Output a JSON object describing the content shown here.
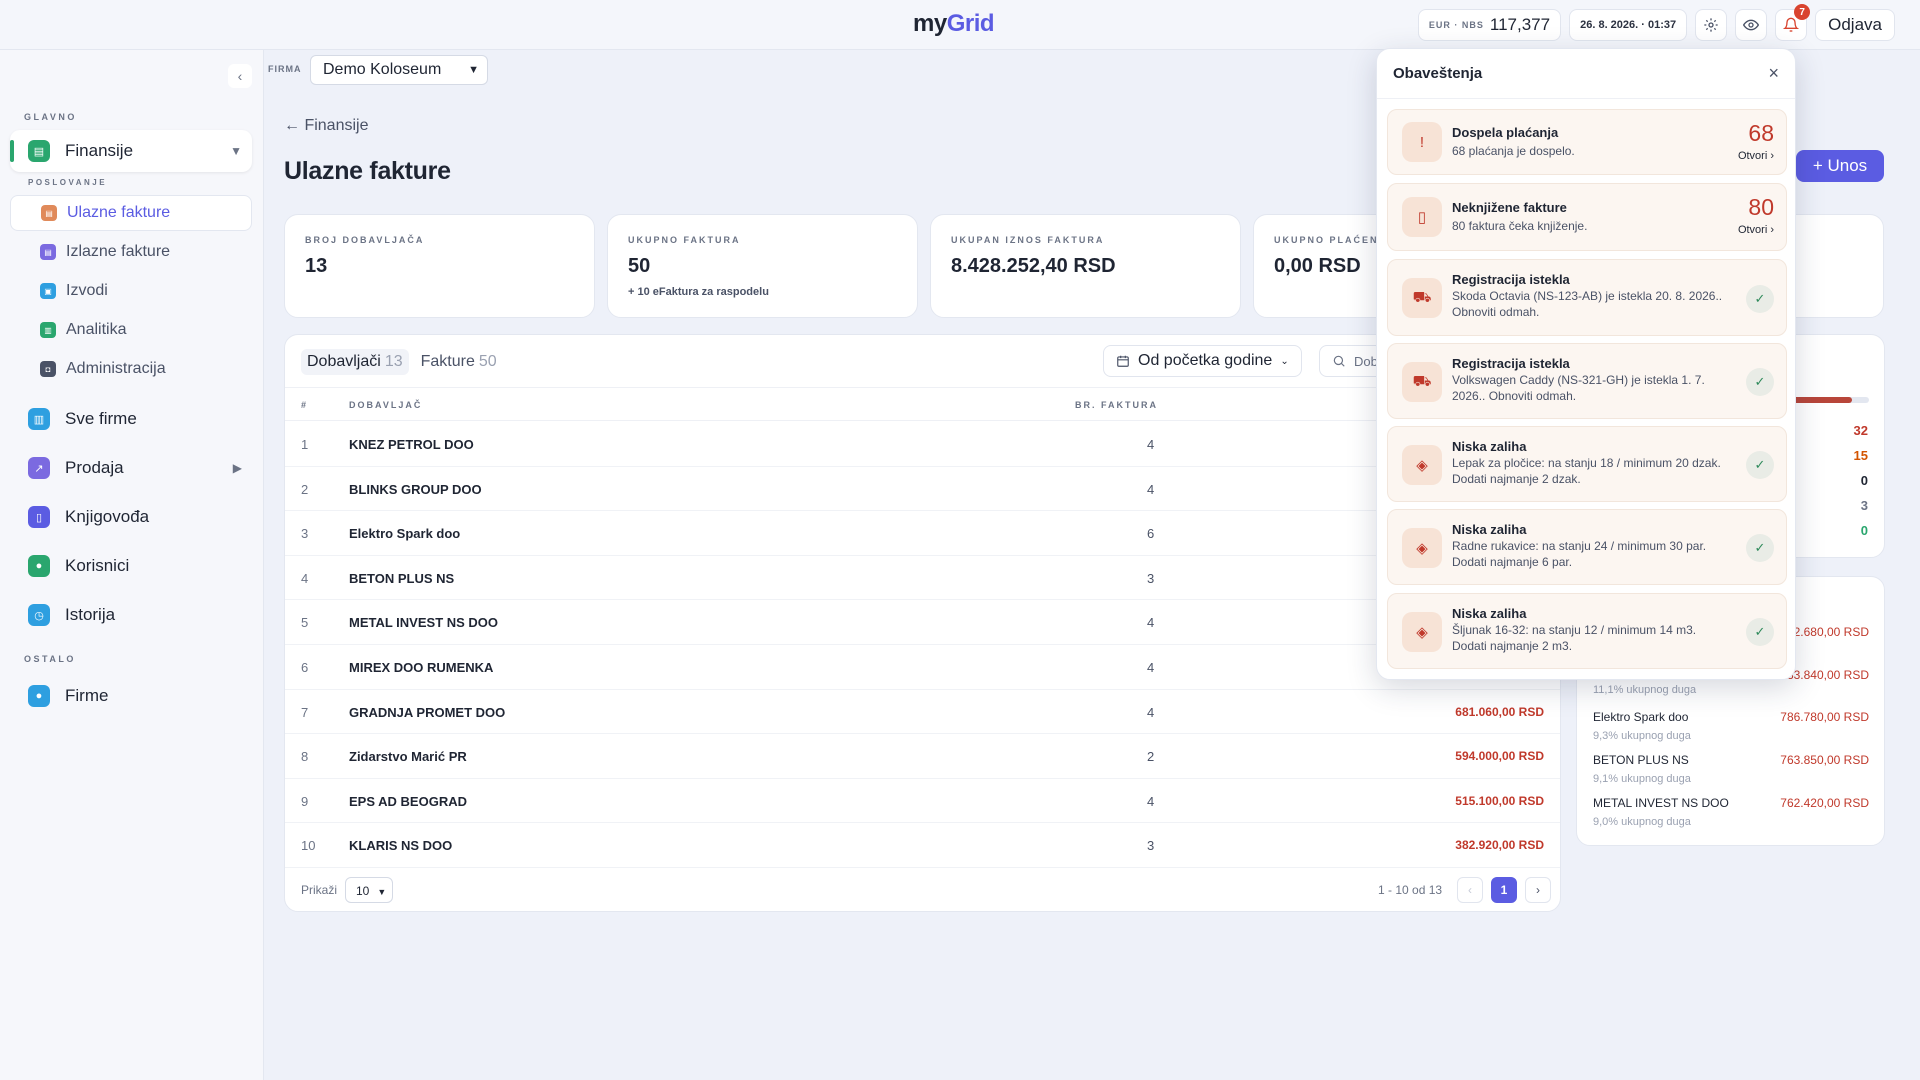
{
  "header": {
    "logo_my": "my",
    "logo_grid": "Grid",
    "rate_label": "EUR · NBS",
    "rate_value": "117,377",
    "datetime": "26. 8. 2026. · 01:37",
    "notif_count": "7",
    "logout": "Odjava"
  },
  "sidebar": {
    "collapse_icon": "‹",
    "section_main": "GLAVNO",
    "finance": "Finansije",
    "section_business": "POSLOVANJE",
    "sub": [
      "Ulazne fakture",
      "Izlazne fakture",
      "Izvodi",
      "Analitika",
      "Administracija"
    ],
    "items": [
      "Sve firme",
      "Prodaja",
      "Knjigovođa",
      "Korisnici",
      "Istorija"
    ],
    "section_other": "OSTALO",
    "firms": "Firme"
  },
  "company": {
    "label": "FIRMA",
    "value": "Demo Koloseum"
  },
  "page": {
    "back": "← Finansije",
    "title": "Ulazne fakture",
    "add": "+ Unos"
  },
  "stats": [
    {
      "label": "BROJ DOBAVLJAČA",
      "value": "13",
      "sub": ""
    },
    {
      "label": "UKUPNO FAKTURA",
      "value": "50",
      "sub": "+ 10 eFaktura za raspodelu"
    },
    {
      "label": "UKUPAN IZNOS FAKTURA",
      "value": "8.428.252,40 RSD",
      "sub": ""
    },
    {
      "label": "UKUPNO PLAĆENO",
      "value": "0,00 RSD",
      "sub": ""
    }
  ],
  "table": {
    "tab_suppliers": "Dobavljači",
    "tab_suppliers_count": "13",
    "tab_invoices": "Fakture",
    "tab_invoices_count": "50",
    "period": "Od početka godine",
    "search_placeholder": "Dob",
    "col_num": "#",
    "col_supplier": "DOBAVLJAČ",
    "col_count": "BR. FAKTURA",
    "rows": [
      {
        "n": "1",
        "name": "KNEZ PETROL DOO",
        "count": "4",
        "amount": ""
      },
      {
        "n": "2",
        "name": "BLINKS GROUP DOO",
        "count": "4",
        "amount": ""
      },
      {
        "n": "3",
        "name": "Elektro Spark doo",
        "count": "6",
        "amount": ""
      },
      {
        "n": "4",
        "name": "BETON PLUS NS",
        "count": "3",
        "amount": ""
      },
      {
        "n": "5",
        "name": "METAL INVEST NS DOO",
        "count": "4",
        "amount": ""
      },
      {
        "n": "6",
        "name": "MIREX DOO RUMENKA",
        "count": "4",
        "amount": ""
      },
      {
        "n": "7",
        "name": "GRADNJA PROMET DOO",
        "count": "4",
        "amount": "681.060,00 RSD"
      },
      {
        "n": "8",
        "name": "Zidarstvo Marić PR",
        "count": "2",
        "amount": "594.000,00 RSD"
      },
      {
        "n": "9",
        "name": "EPS AD BEOGRAD",
        "count": "4",
        "amount": "515.100,00 RSD"
      },
      {
        "n": "10",
        "name": "KLARIS NS DOO",
        "count": "3",
        "amount": "382.920,00 RSD"
      }
    ],
    "show_label": "Prikaži",
    "page_size": "10",
    "range": "1 - 10 od 13",
    "prev": "‹",
    "page": "1",
    "next": "›"
  },
  "side1": {
    "fill_fraction": 0.94,
    "nums": [
      "32",
      "15",
      "0",
      "3",
      "0"
    ]
  },
  "side2": {
    "top_amount": "2.680,00 RSD",
    "second_amount": "33.840,00 RSD",
    "second_pct": "11,1% ukupnog duga",
    "debtors": [
      {
        "name": "Elektro Spark doo",
        "amount": "786.780,00 RSD",
        "pct": "9,3% ukupnog duga"
      },
      {
        "name": "BETON PLUS NS",
        "amount": "763.850,00 RSD",
        "pct": "9,1% ukupnog duga"
      },
      {
        "name": "METAL INVEST NS DOO",
        "amount": "762.420,00 RSD",
        "pct": "9,0% ukupnog duga"
      }
    ]
  },
  "notifications": {
    "title": "Obaveštenja",
    "close": "×",
    "items": [
      {
        "title": "Dospela plaćanja",
        "desc": "68 plaćanja je dospelo.",
        "big": "68",
        "open": "Otvori ›",
        "icon": "!"
      },
      {
        "title": "Neknjižene fakture",
        "desc": "80 faktura čeka knjiženje.",
        "big": "80",
        "open": "Otvori ›",
        "icon": "▯"
      },
      {
        "title": "Registracija istekla",
        "desc": "Skoda Octavia (NS-123-AB) je istekla 20. 8. 2026.. Obnoviti odmah.",
        "icon": "⛟"
      },
      {
        "title": "Registracija istekla",
        "desc": "Volkswagen Caddy (NS-321-GH) je istekla 1. 7. 2026.. Obnoviti odmah.",
        "icon": "⛟"
      },
      {
        "title": "Niska zaliha",
        "desc": "Lepak za pločice: na stanju 18 / minimum 20 dzak. Dodati najmanje 2 dzak.",
        "icon": "◈"
      },
      {
        "title": "Niska zaliha",
        "desc": "Radne rukavice: na stanju 24 / minimum 30 par. Dodati najmanje 6 par.",
        "icon": "◈"
      },
      {
        "title": "Niska zaliha",
        "desc": "Šljunak 16-32: na stanju 12 / minimum 14 m3. Dodati najmanje 2 m3.",
        "icon": "◈"
      }
    ],
    "check": "✓"
  }
}
